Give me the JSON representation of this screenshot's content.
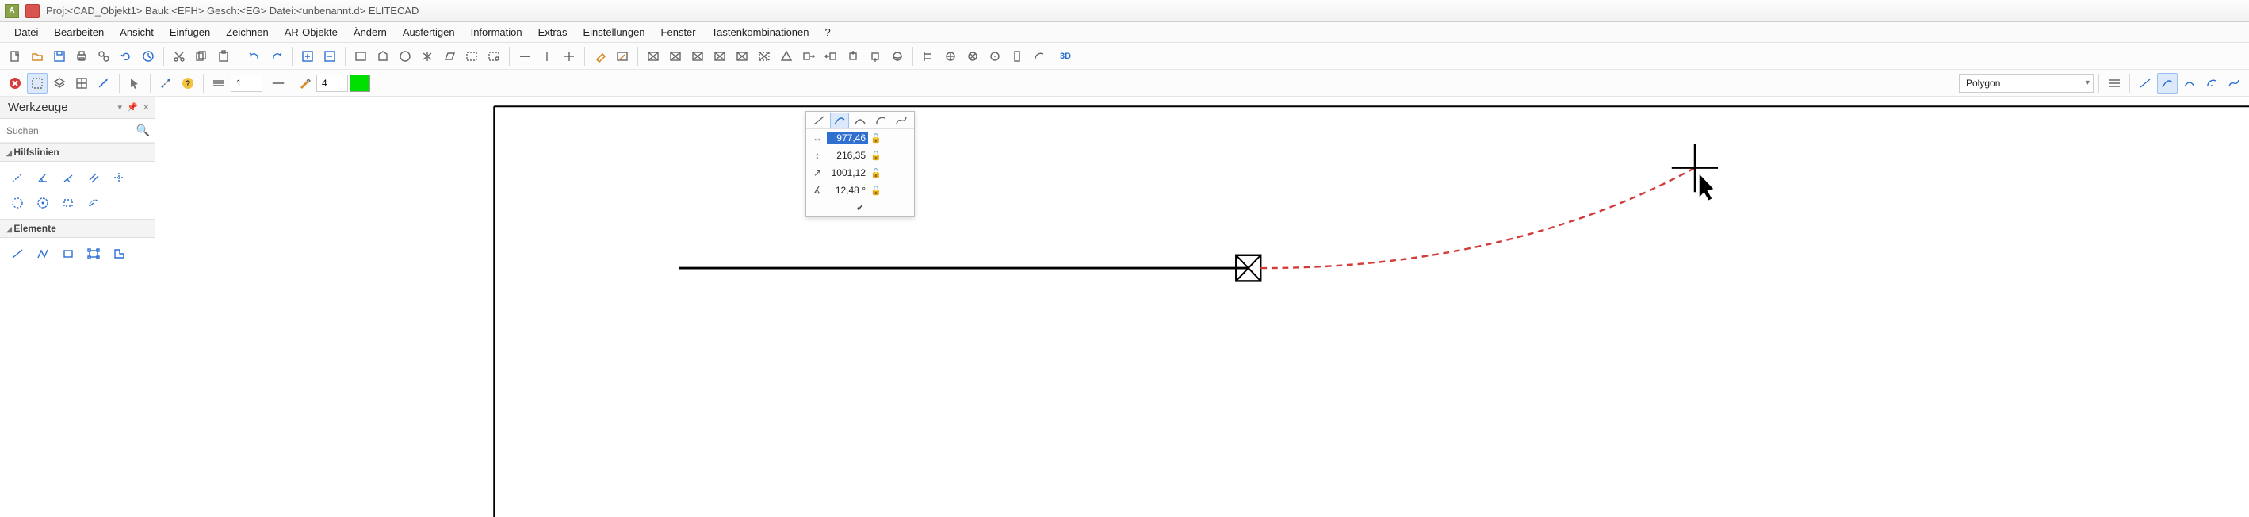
{
  "app": {
    "title": "Proj:<CAD_Objekt1>  Bauk:<EFH>   Gesch:<EG>   Datei:<unbenannt.d>  ELITECAD"
  },
  "menu": {
    "items": [
      "Datei",
      "Bearbeiten",
      "Ansicht",
      "Einfügen",
      "Zeichnen",
      "AR-Objekte",
      "Ändern",
      "Ausfertigen",
      "Information",
      "Extras",
      "Einstellungen",
      "Fenster",
      "Tastenkombinationen",
      "?"
    ]
  },
  "toolbar1": {
    "icons": [
      "new-file-icon",
      "open-folder-icon",
      "save-icon",
      "print-icon",
      "copy-properties-icon",
      "refresh-icon",
      "clock-icon",
      "_sep",
      "cut-icon",
      "copy-icon",
      "paste-icon",
      "_sep",
      "undo-icon",
      "redo-icon",
      "_sep",
      "zoom-in-plus-icon",
      "zoom-out-minus-icon",
      "_sep",
      "rect-select-icon",
      "poly-select-icon",
      "circle-select-icon",
      "mirror-icon",
      "skew-select-icon",
      "dashed-select-icon",
      "lasso-icon",
      "_sep",
      "axis-horizontal-icon",
      "axis-vertical-icon",
      "axis-both-icon",
      "_sep",
      "eraser-icon",
      "edit-region-icon",
      "_sep",
      "box-x1-icon",
      "box-x2-icon",
      "box-x3-icon",
      "box-x4-icon",
      "box-x5-icon",
      "box-x6-icon",
      "pyramid-icon",
      "push-right-icon",
      "push-left-icon",
      "push-in-icon",
      "push-out-icon",
      "rotate-3d-icon",
      "_sep",
      "align-left-icon",
      "align-center-icon",
      "align-right-icon",
      "snap-icon",
      "column-icon",
      "arc-icon",
      "3d-icon"
    ],
    "label_3d": "3D"
  },
  "toolbar2": {
    "polygon_label": "Polygon",
    "line_type_value": "1",
    "pen_value": "4"
  },
  "sidebar": {
    "title": "Werkzeuge",
    "search_placeholder": "Suchen",
    "sections": {
      "hilfslinien": "Hilfslinien",
      "elemente": "Elemente"
    }
  },
  "float": {
    "dx_label": "↔",
    "dy_label": "↕",
    "len_label": "↗",
    "ang_label": "∡",
    "dx": "977,46",
    "dy": "216,35",
    "len": "1001,12",
    "ang": "12,48 °"
  }
}
